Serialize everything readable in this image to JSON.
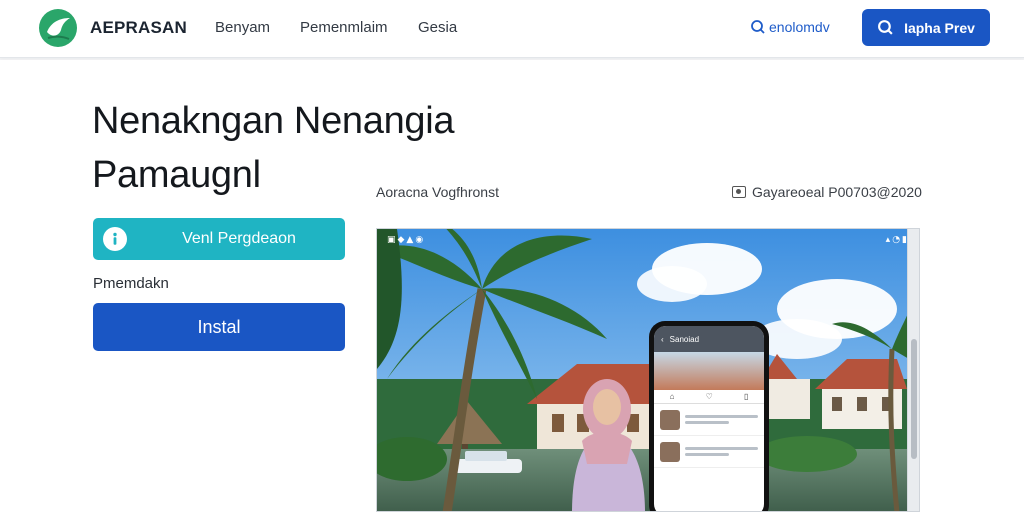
{
  "header": {
    "brand": "AEPRASAN",
    "nav": [
      "Benyam",
      "Pemenmlaim",
      "Gesia"
    ],
    "search_link": "enolomdv",
    "cta_label": "Iapha Prev"
  },
  "hero": {
    "title": "Nenakngan Nenangia Pamaugnl"
  },
  "actions": {
    "primary_label": "Venl Pergdeaon",
    "section_label": "Pmemdakn",
    "install_label": "Instal"
  },
  "preview": {
    "caption": "Aoracna Vogfhronst",
    "meta": "Gayareoeal P00703@2020",
    "phone_header": "Sanoiad",
    "icons": [
      "logo-icon",
      "search-icon",
      "info-icon",
      "image-icon",
      "back-icon"
    ]
  },
  "colors": {
    "brand_green": "#2aa66a",
    "primary_blue": "#1a56c4",
    "teal": "#1fb4c3"
  }
}
